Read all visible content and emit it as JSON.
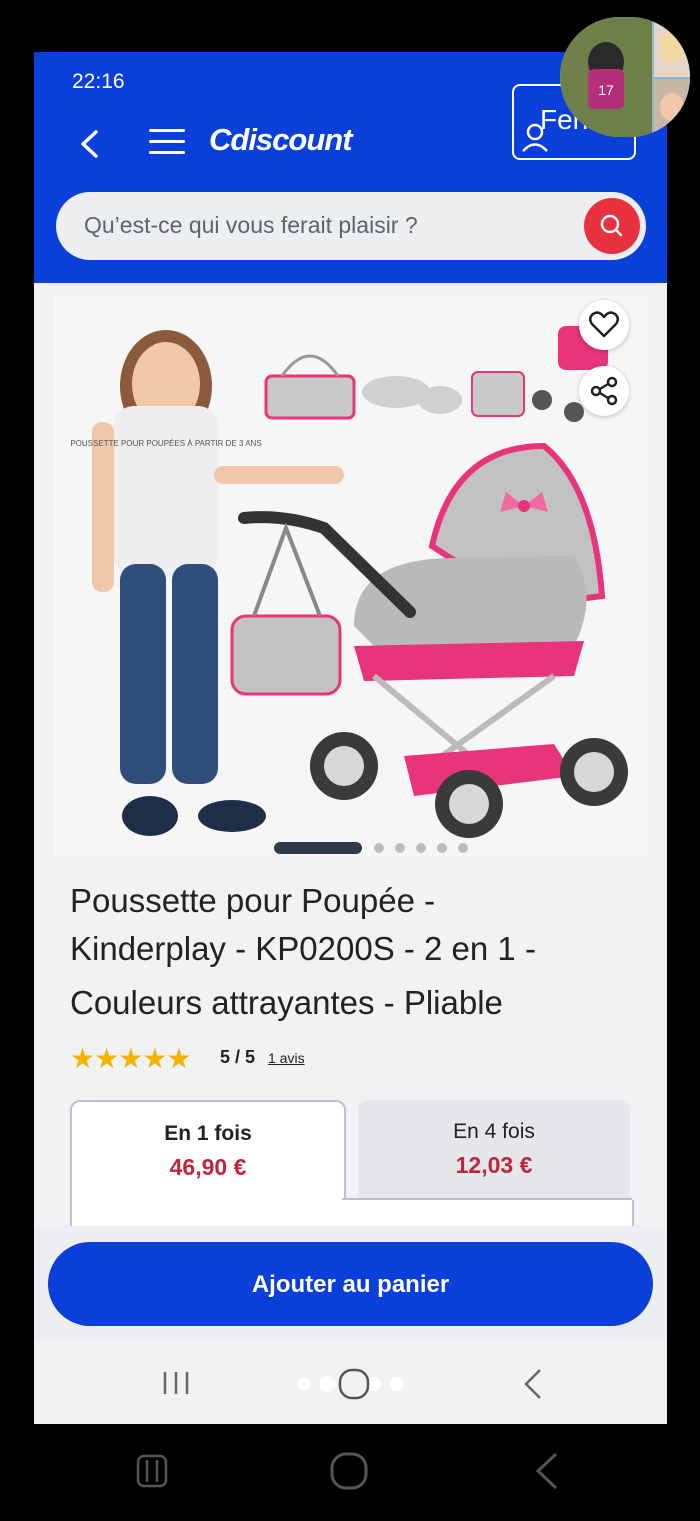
{
  "status": {
    "time": "22:16",
    "icons": "4G"
  },
  "header": {
    "logo": "Cdiscount",
    "account_label": "Ferr"
  },
  "search": {
    "placeholder": "Qu’est-ce qui vous ferait plaisir ?"
  },
  "product": {
    "title_lines": [
      "Poussette pour Poupée -",
      "Kinderplay - KP0200S - 2 en 1 -",
      "Couleurs attrayantes - Pliable"
    ],
    "image_shirt_text": "POUSSETTE POUR POUPÉES À PARTIR DE 3 ANS",
    "stars": "★★★★★",
    "rating_text": "5 / 5",
    "rating_value": 5,
    "rating_max": 5,
    "reviews_text": "1 avis",
    "image_count": 6,
    "image_active_index": 0
  },
  "payment": {
    "tabs": [
      {
        "label": "En 1 fois",
        "price": "46,90 €",
        "selected": true
      },
      {
        "label": "En 4 fois",
        "price": "12,03 €",
        "selected": false
      }
    ]
  },
  "cta": {
    "add_to_cart": "Ajouter au panier"
  },
  "colors": {
    "brand_blue": "#0b3fd9",
    "price_red": "#c0263a",
    "star_yellow": "#f4b400",
    "search_red": "#e8303f",
    "pink": "#e8347a"
  }
}
